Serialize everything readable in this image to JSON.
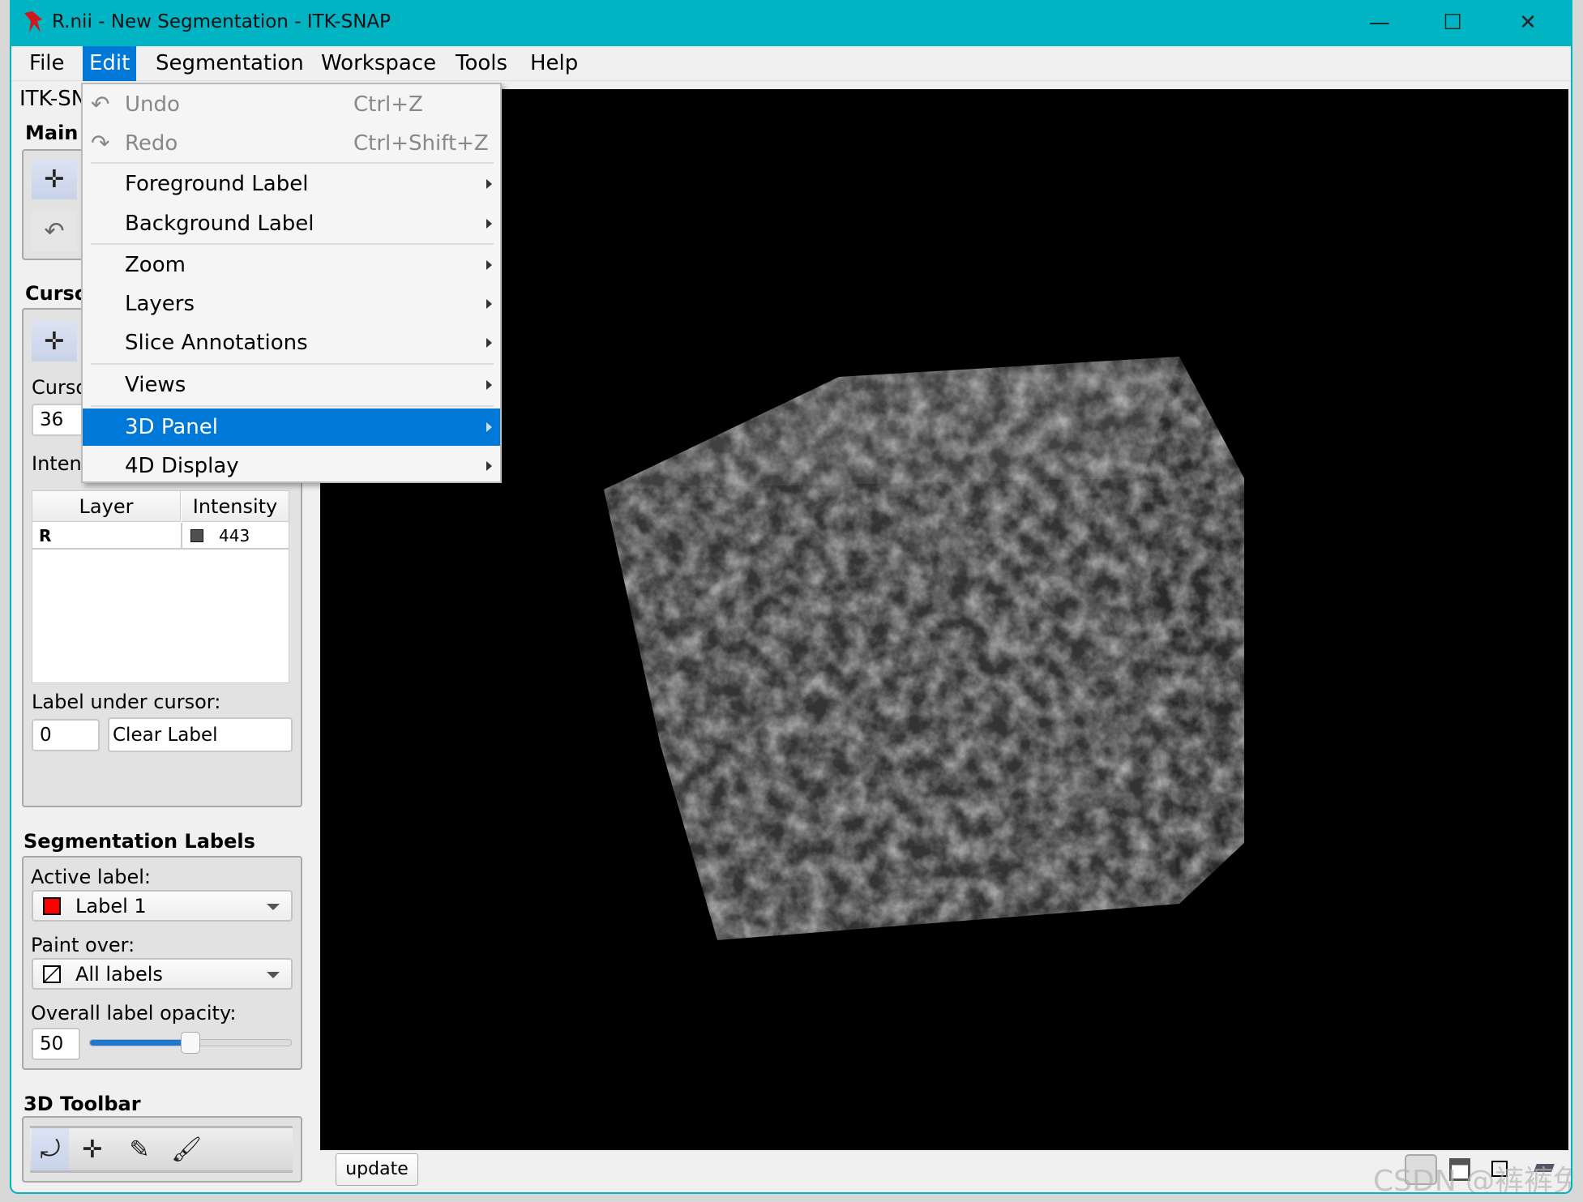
{
  "window": {
    "title": "R.nii - New Segmentation - ITK-SNAP",
    "accent": "#00b4c4",
    "minimize": "—",
    "maximize": "☐",
    "close": "✕"
  },
  "menubar": [
    "File",
    "Edit",
    "Segmentation",
    "Workspace",
    "Tools",
    "Help"
  ],
  "edit_menu": {
    "undo": {
      "label": "Undo",
      "shortcut": "Ctrl+Z"
    },
    "redo": {
      "label": "Redo",
      "shortcut": "Ctrl+Shift+Z"
    },
    "items": [
      "Foreground Label",
      "Background Label",
      "Zoom",
      "Layers",
      "Slice Annotations",
      "Views",
      "3D Panel",
      "4D Display"
    ],
    "highlighted": "3D Panel"
  },
  "left_panel": {
    "app_label": "ITK-SN",
    "main_toolbar_heading": "Main",
    "cursor_heading": "Curso",
    "cursor_label": "Curso",
    "cursor_value": "36",
    "intensity_label": "Inten",
    "table": {
      "headers": [
        "Layer",
        "Intensity"
      ],
      "rows": [
        {
          "layer": "R",
          "intensity": "443",
          "swatch": "#505050"
        }
      ]
    },
    "label_under_cursor": "Label under cursor:",
    "label_value": "0",
    "label_name": "Clear Label"
  },
  "seg_labels": {
    "heading": "Segmentation Labels",
    "active_label": "Active label:",
    "active_value": "Label 1",
    "active_color": "#ff0000",
    "paint_over": "Paint over:",
    "paint_value": "All labels",
    "opacity_label": "Overall label opacity:",
    "opacity_value": "50",
    "opacity_fraction": 0.5
  },
  "toolbar3d": {
    "heading": "3D Toolbar",
    "icons": [
      "rotate-icon",
      "crosshair-icon",
      "scalpel-icon",
      "spraypaint-icon"
    ]
  },
  "viewport": {
    "update_button": "update"
  },
  "watermark": "CSDN @裤裤兔"
}
